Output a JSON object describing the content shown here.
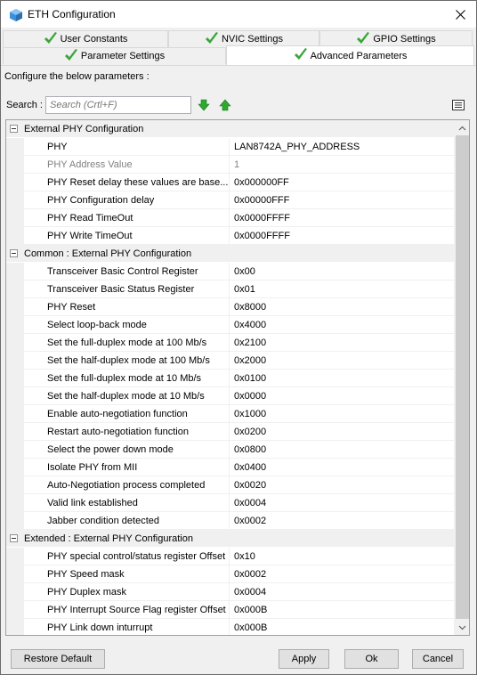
{
  "window": {
    "title": "ETH Configuration"
  },
  "tabs_row1": [
    {
      "label": "User Constants"
    },
    {
      "label": "NVIC Settings"
    },
    {
      "label": "GPIO Settings"
    }
  ],
  "tabs_row2": [
    {
      "label": "Parameter Settings"
    },
    {
      "label": "Advanced Parameters"
    }
  ],
  "configure_label": "Configure the below parameters :",
  "search": {
    "label": "Search :",
    "placeholder": "Search (Crtl+F)"
  },
  "groups": [
    {
      "title": "External PHY Configuration",
      "rows": [
        {
          "name": "PHY",
          "value": "LAN8742A_PHY_ADDRESS",
          "disabled": false
        },
        {
          "name": "PHY Address Value",
          "value": "1",
          "disabled": true
        },
        {
          "name": "PHY Reset delay these values are base...",
          "value": "0x000000FF",
          "disabled": false
        },
        {
          "name": "PHY Configuration delay",
          "value": "0x00000FFF",
          "disabled": false
        },
        {
          "name": "PHY Read TimeOut",
          "value": "0x0000FFFF",
          "disabled": false
        },
        {
          "name": "PHY Write TimeOut",
          "value": "0x0000FFFF",
          "disabled": false
        }
      ]
    },
    {
      "title": "Common : External PHY Configuration",
      "rows": [
        {
          "name": "Transceiver Basic Control Register",
          "value": "0x00",
          "disabled": false
        },
        {
          "name": "Transceiver Basic Status Register",
          "value": "0x01",
          "disabled": false
        },
        {
          "name": "PHY Reset",
          "value": "0x8000",
          "disabled": false
        },
        {
          "name": "Select loop-back mode",
          "value": "0x4000",
          "disabled": false
        },
        {
          "name": "Set the full-duplex mode at 100 Mb/s",
          "value": "0x2100",
          "disabled": false
        },
        {
          "name": "Set the half-duplex mode at 100 Mb/s",
          "value": "0x2000",
          "disabled": false
        },
        {
          "name": "Set the full-duplex mode at 10 Mb/s",
          "value": "0x0100",
          "disabled": false
        },
        {
          "name": "Set the half-duplex mode at 10 Mb/s",
          "value": "0x0000",
          "disabled": false
        },
        {
          "name": "Enable auto-negotiation function",
          "value": "0x1000",
          "disabled": false
        },
        {
          "name": "Restart auto-negotiation function",
          "value": "0x0200",
          "disabled": false
        },
        {
          "name": "Select the power down mode",
          "value": "0x0800",
          "disabled": false
        },
        {
          "name": "Isolate PHY from MII",
          "value": "0x0400",
          "disabled": false
        },
        {
          "name": "Auto-Negotiation process completed",
          "value": "0x0020",
          "disabled": false
        },
        {
          "name": "Valid link established",
          "value": "0x0004",
          "disabled": false
        },
        {
          "name": "Jabber condition detected",
          "value": "0x0002",
          "disabled": false
        }
      ]
    },
    {
      "title": "Extended : External PHY Configuration",
      "rows": [
        {
          "name": "PHY special control/status register Offset",
          "value": "0x10",
          "disabled": false
        },
        {
          "name": "PHY Speed mask",
          "value": "0x0002",
          "disabled": false
        },
        {
          "name": "PHY Duplex mask",
          "value": "0x0004",
          "disabled": false
        },
        {
          "name": "PHY Interrupt Source Flag register Offset",
          "value": "0x000B",
          "disabled": false
        },
        {
          "name": "PHY Link down inturrupt",
          "value": "0x000B",
          "disabled": false
        }
      ]
    }
  ],
  "buttons": {
    "restore_default": "Restore Default",
    "apply": "Apply",
    "ok": "Ok",
    "cancel": "Cancel"
  },
  "colors": {
    "check_green": "#3aa53a",
    "arrow_green": "#2fa82f"
  }
}
